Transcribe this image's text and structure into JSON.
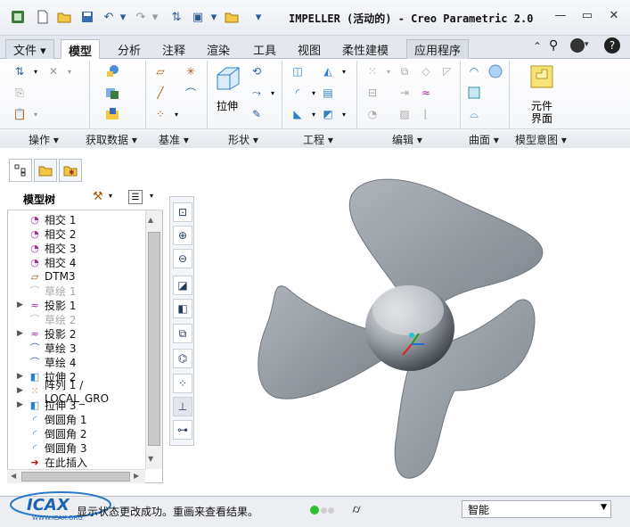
{
  "title": "IMPELLER (活动的) - Creo Parametric 2.0",
  "window_controls": {
    "minimize": "—",
    "restore": "▭",
    "close": "✕"
  },
  "tabs": [
    {
      "label": "文件 ▾"
    },
    {
      "label": "模型"
    },
    {
      "label": "分析"
    },
    {
      "label": "注释"
    },
    {
      "label": "渲染"
    },
    {
      "label": "工具"
    },
    {
      "label": "视图"
    },
    {
      "label": "柔性建模"
    },
    {
      "label": "应用程序"
    }
  ],
  "ribbon": {
    "extrude_label": "拉伸",
    "component_label_1": "元件",
    "component_label_2": "界面",
    "groups": [
      {
        "label": "操作 ▾"
      },
      {
        "label": "获取数据 ▾"
      },
      {
        "label": "基准 ▾"
      },
      {
        "label": "形状 ▾"
      },
      {
        "label": "工程 ▾"
      },
      {
        "label": "编辑 ▾"
      },
      {
        "label": "曲面 ▾"
      },
      {
        "label": "模型意图 ▾"
      }
    ]
  },
  "model_tree": {
    "header": "模型树",
    "items": [
      {
        "label": "相交 1",
        "icon": "intersect-icon",
        "expandable": false,
        "dim": false
      },
      {
        "label": "相交 2",
        "icon": "intersect-icon",
        "expandable": false,
        "dim": false
      },
      {
        "label": "相交 3",
        "icon": "intersect-icon",
        "expandable": false,
        "dim": false
      },
      {
        "label": "相交 4",
        "icon": "intersect-icon",
        "expandable": false,
        "dim": false
      },
      {
        "label": "DTM3",
        "icon": "datum-plane-icon",
        "expandable": false,
        "dim": false
      },
      {
        "label": "草绘 1",
        "icon": "sketch-icon",
        "expandable": false,
        "dim": true
      },
      {
        "label": "投影 1",
        "icon": "projection-icon",
        "expandable": true,
        "dim": false
      },
      {
        "label": "草绘 2",
        "icon": "sketch-icon",
        "expandable": false,
        "dim": true
      },
      {
        "label": "投影 2",
        "icon": "projection-icon",
        "expandable": true,
        "dim": false
      },
      {
        "label": "草绘 3",
        "icon": "sketch-icon",
        "expandable": false,
        "dim": false
      },
      {
        "label": "草绘 4",
        "icon": "sketch-icon",
        "expandable": false,
        "dim": false
      },
      {
        "label": "拉伸 2",
        "icon": "extrude-icon",
        "expandable": true,
        "dim": false
      },
      {
        "label": "阵列 1 / LOCAL_GRO",
        "icon": "pattern-icon",
        "expandable": true,
        "dim": false
      },
      {
        "label": "拉伸 3",
        "icon": "extrude-icon",
        "expandable": true,
        "dim": false
      },
      {
        "label": "倒圆角 1",
        "icon": "round-icon",
        "expandable": false,
        "dim": false
      },
      {
        "label": "倒圆角 2",
        "icon": "round-icon",
        "expandable": false,
        "dim": false
      },
      {
        "label": "倒圆角 3",
        "icon": "round-icon",
        "expandable": false,
        "dim": false
      },
      {
        "label": "在此插入",
        "icon": "insert-arrow-icon",
        "expandable": false,
        "dim": false
      }
    ]
  },
  "status": {
    "message": "显示状态更改成功。重画来查看结果。",
    "watermark": "ICAX WWW.ICAX.ORG",
    "filter_value": "智能"
  },
  "colors": {
    "accent": "#2c5c91",
    "model_gray": "#8b9299",
    "ribbon_bg": "#f1f3f6"
  }
}
